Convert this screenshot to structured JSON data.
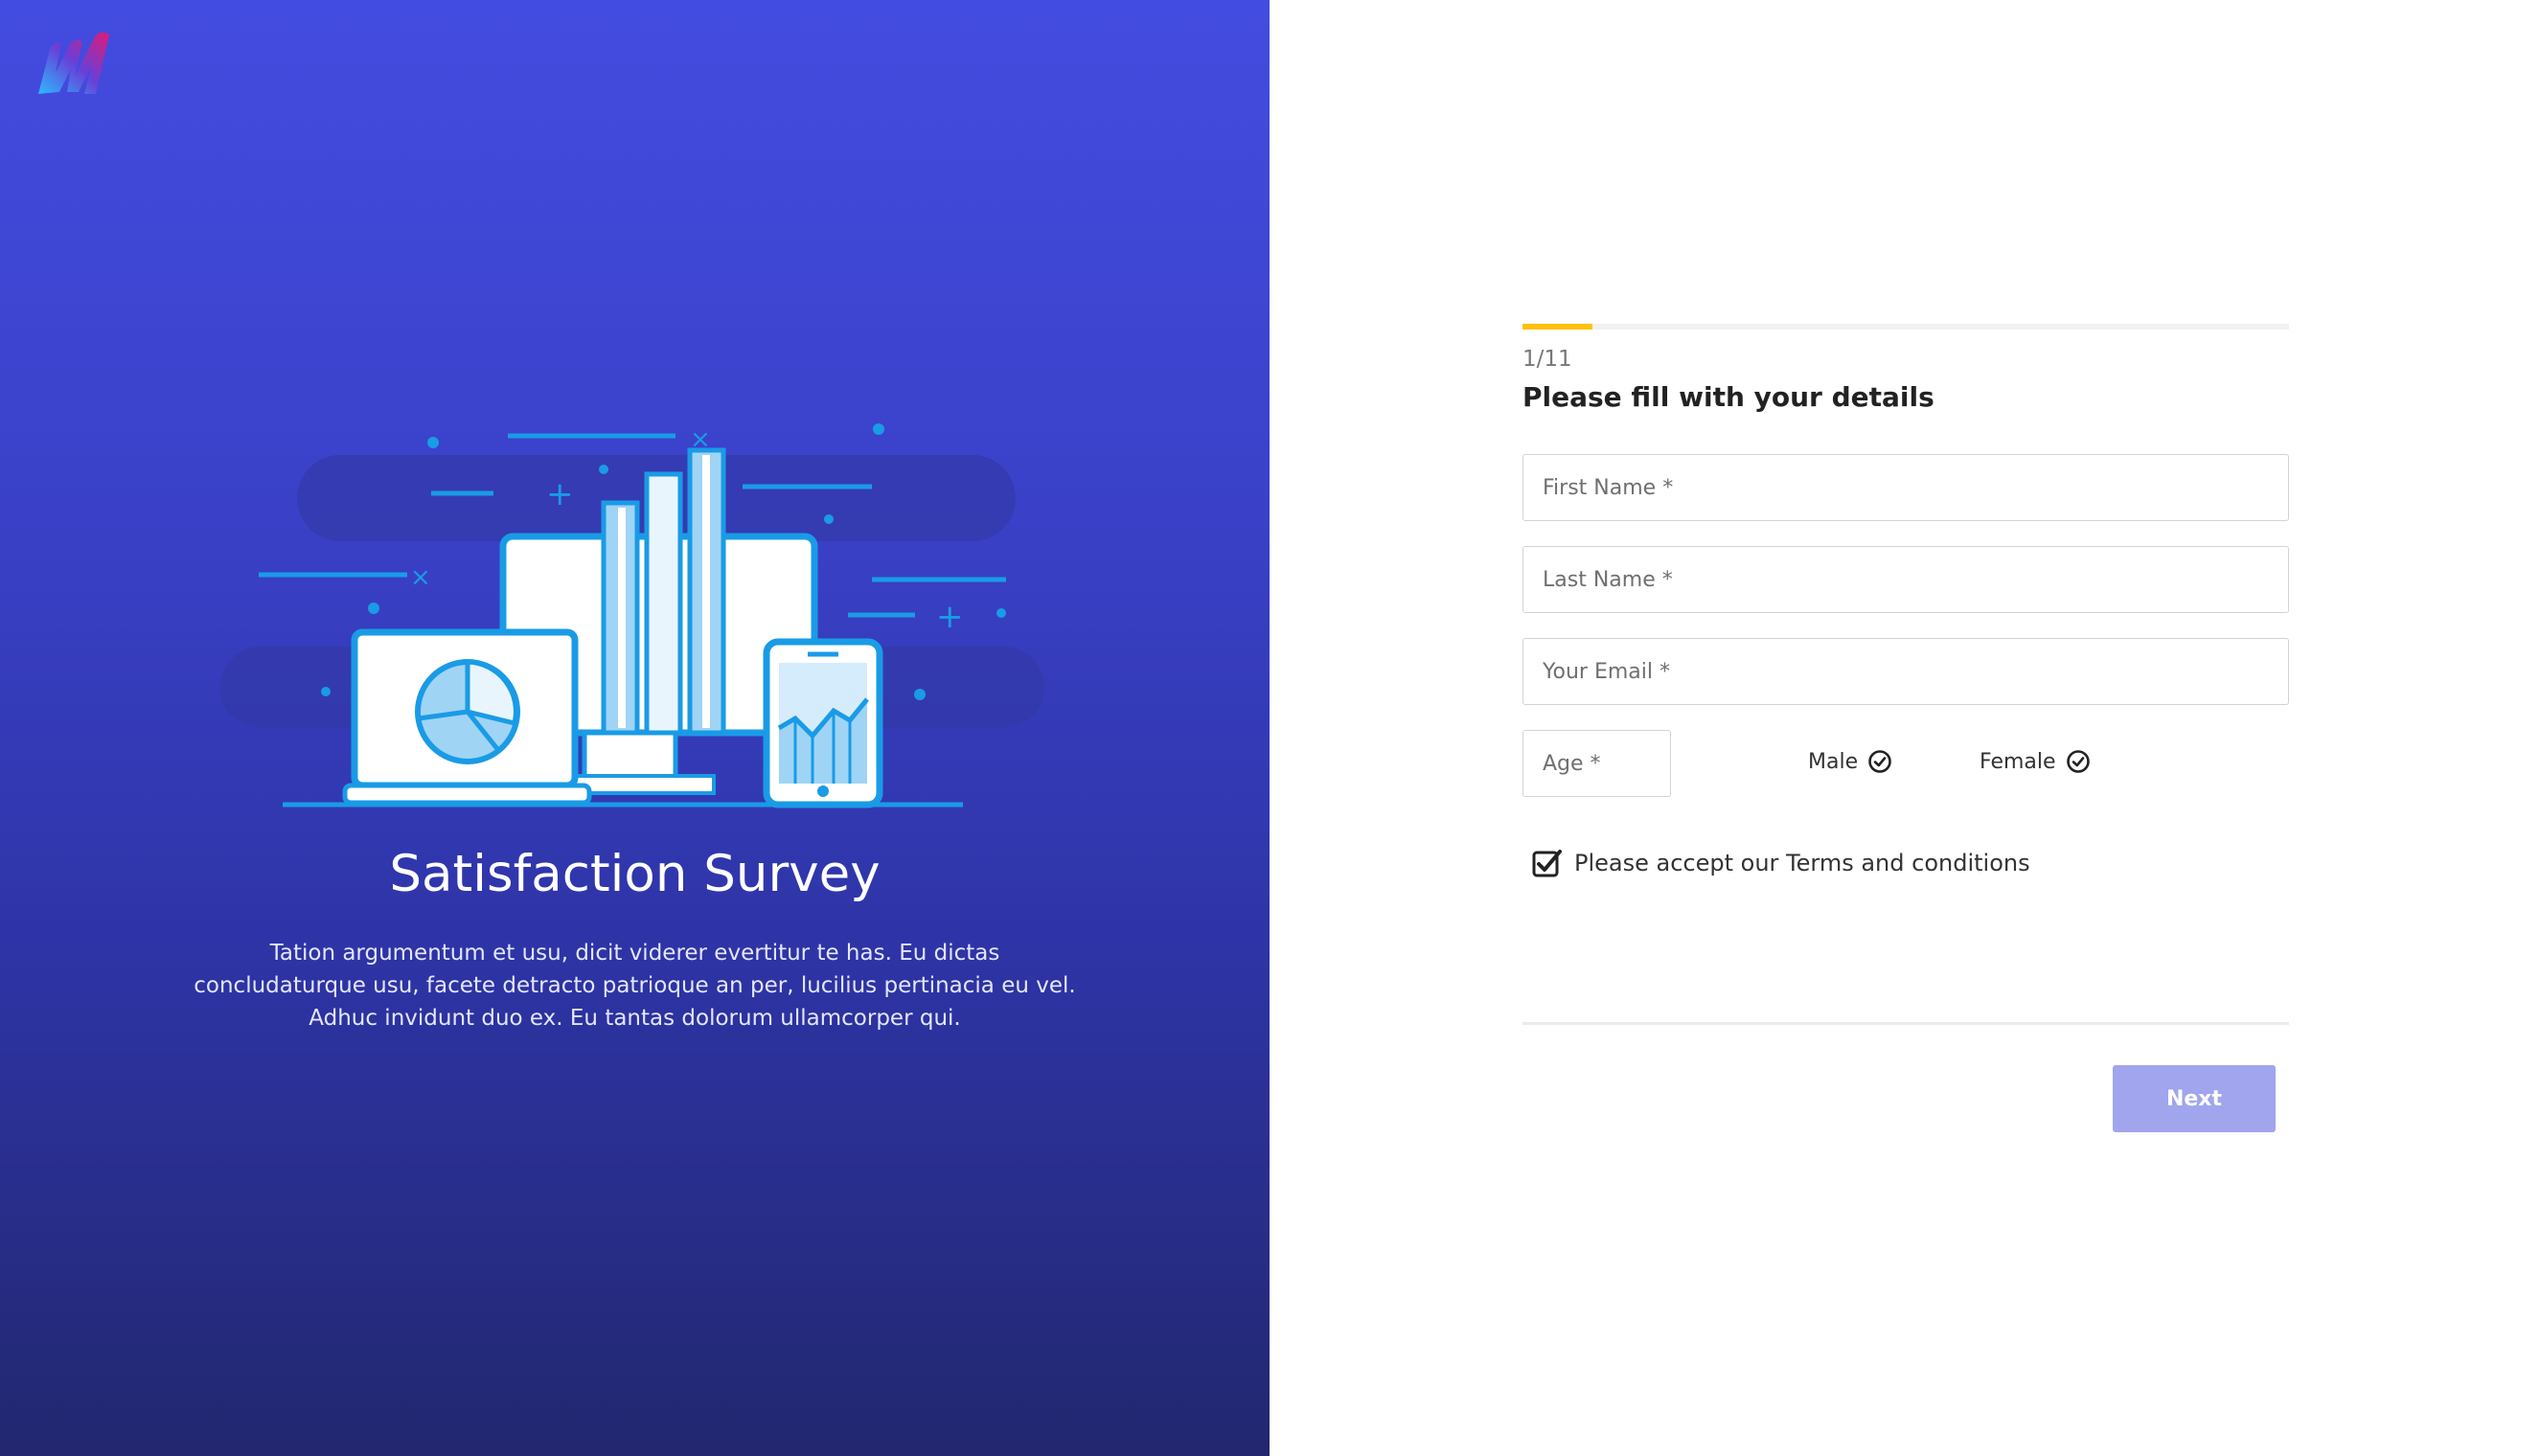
{
  "brand": {
    "logo_icon": "brand-logo-icon"
  },
  "hero": {
    "title": "Satisfaction Survey",
    "description": "Tation argumentum et usu, dicit viderer evertitur te has. Eu dictas concludaturque usu, facete detracto patrioque an per, lucilius pertinacia eu vel. Adhuc invidunt duo ex. Eu tantas dolorum ullamcorper qui.",
    "illustration_icon": "devices-analytics-illustration"
  },
  "form": {
    "progress": {
      "label": "1/11",
      "fraction": 0.0909
    },
    "heading": "Please fill with your details",
    "fields": {
      "first_name": {
        "placeholder": "First Name *",
        "value": ""
      },
      "last_name": {
        "placeholder": "Last Name *",
        "value": ""
      },
      "email": {
        "placeholder": "Your Email *",
        "value": ""
      },
      "age": {
        "placeholder": "Age *",
        "value": ""
      }
    },
    "gender": {
      "options": [
        {
          "label": "Male",
          "icon": "check-circle-icon"
        },
        {
          "label": "Female",
          "icon": "check-circle-icon"
        }
      ]
    },
    "terms": {
      "label": "Please accept our Terms and conditions",
      "checked": true,
      "icon": "checkbox-checked-icon"
    },
    "next_label": "Next"
  },
  "colors": {
    "panel_gradient_top": "#434ce0",
    "panel_gradient_bottom": "#22276f",
    "progress_accent": "#ffc107",
    "button_bg": "#a0a5ee"
  }
}
